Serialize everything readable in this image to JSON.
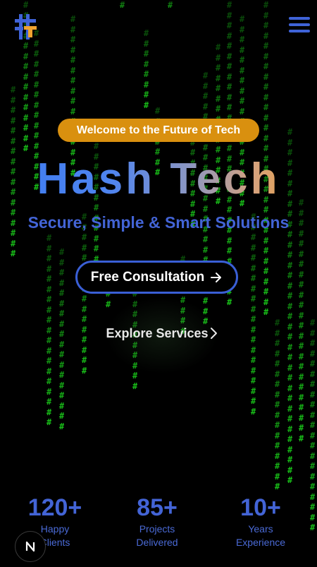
{
  "header": {
    "logo_icon": "hash-t-logo-icon",
    "menu_icon": "hamburger-menu-icon",
    "colors": {
      "logo_blue": "#3f63d8",
      "logo_orange": "#f0a330"
    }
  },
  "hero": {
    "badge": "Welcome to the Future of Tech",
    "title": "Hash Tech",
    "tagline": "Secure, Simple & Smart Solutions",
    "primary_button": "Free Consultation",
    "secondary_button": "Explore Services"
  },
  "stats": [
    {
      "value": "120+",
      "label_line1": "Happy",
      "label_line2": "Clients"
    },
    {
      "value": "85+",
      "label_line1": "Projects",
      "label_line2": "Delivered"
    },
    {
      "value": "10+",
      "label_line1": "Years",
      "label_line2": "Experience"
    }
  ],
  "floating_button": {
    "icon": "next-n-icon"
  },
  "colors": {
    "background": "#000000",
    "matrix_green": "#19c219",
    "accent_blue": "#4364d6",
    "badge_orange": "#d9900f"
  }
}
